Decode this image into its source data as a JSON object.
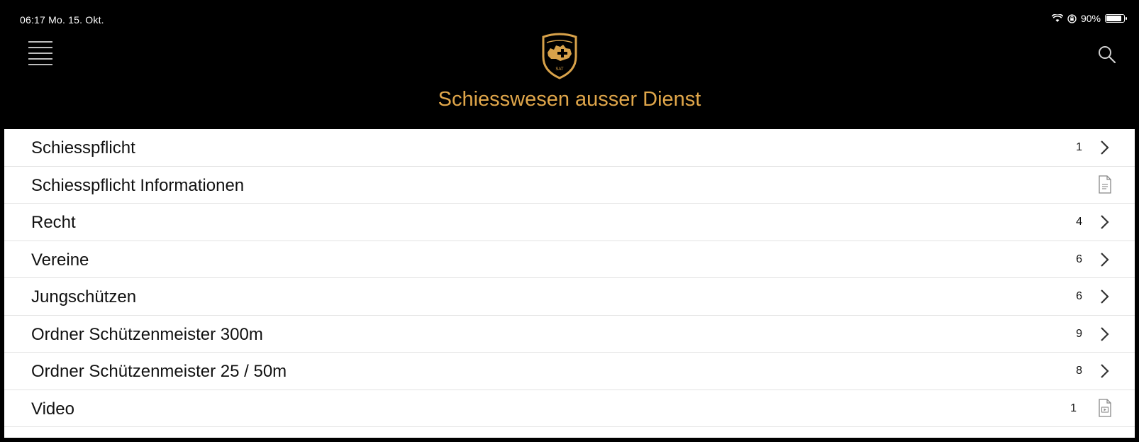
{
  "status_bar": {
    "time_date": "06:17  Mo. 15. Okt.",
    "battery": "90%",
    "battery_level": 0.9,
    "icons": [
      "wifi-icon",
      "orientation-lock-icon",
      "battery-icon"
    ]
  },
  "header": {
    "title": "Schiesswesen ausser Dienst",
    "logo_text": "SAT",
    "title_color": "#e0a64a",
    "background": "#000000"
  },
  "list": [
    {
      "label": "Schiesspflicht",
      "count": "1",
      "icon": "chevron-right-icon"
    },
    {
      "label": "Schiesspflicht Informationen",
      "count": "",
      "icon": "document-icon"
    },
    {
      "label": "Recht",
      "count": "4",
      "icon": "chevron-right-icon"
    },
    {
      "label": "Vereine",
      "count": "6",
      "icon": "chevron-right-icon"
    },
    {
      "label": "Jungschützen",
      "count": "6",
      "icon": "chevron-right-icon"
    },
    {
      "label": "Ordner Schützenmeister 300m",
      "count": "9",
      "icon": "chevron-right-icon"
    },
    {
      "label": "Ordner Schützenmeister 25 / 50m",
      "count": "8",
      "icon": "chevron-right-icon"
    },
    {
      "label": "Video",
      "count": "1",
      "icon": "video-file-icon"
    }
  ]
}
